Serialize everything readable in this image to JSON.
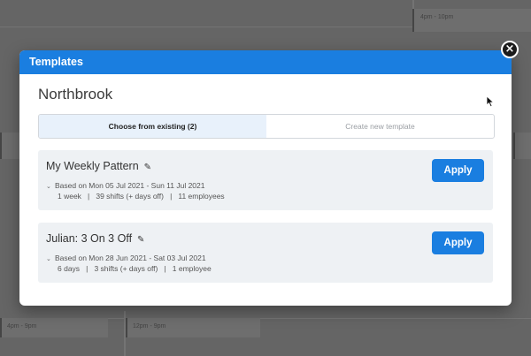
{
  "background": {
    "texts": [
      "4pm - 10pm",
      "4pm - 9pm",
      "12pm - 9pm"
    ]
  },
  "modal": {
    "title": "Templates",
    "close_symbol": "×",
    "location": "Northbrook",
    "tabs": [
      {
        "label": "Choose from existing (2)",
        "active": true
      },
      {
        "label": "Create new template",
        "active": false
      }
    ],
    "templates": [
      {
        "name": "My Weekly Pattern",
        "based_on": "Based on Mon 05 Jul 2021 - Sun 11 Jul 2021",
        "duration": "1 week",
        "shifts": "39 shifts (+ days off)",
        "employees": "11 employees",
        "apply_label": "Apply"
      },
      {
        "name": "Julian: 3 On 3 Off",
        "based_on": "Based on Mon 28 Jun 2021 - Sat 03 Jul 2021",
        "duration": "6 days",
        "shifts": "3 shifts (+ days off)",
        "employees": "1 employee",
        "apply_label": "Apply"
      }
    ],
    "separator": "|"
  },
  "icons": {
    "edit": "pencil-icon",
    "expand": "chevron-down-icon",
    "close": "close-icon",
    "cursor": "mouse-cursor-icon"
  },
  "colors": {
    "accent": "#1a7ee0",
    "card_bg": "#eef1f4",
    "active_tab_bg": "#e8f1fb"
  }
}
